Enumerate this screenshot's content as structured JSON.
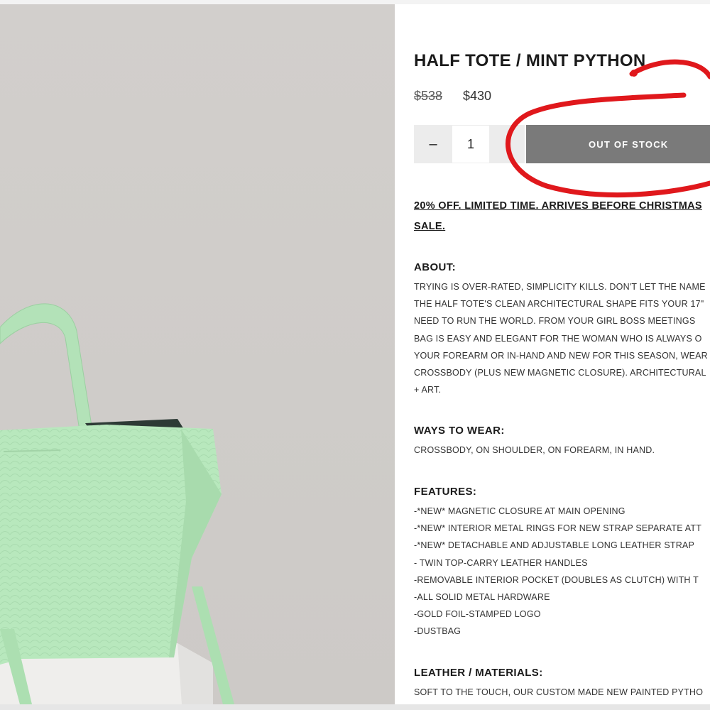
{
  "product": {
    "title": "HALF TOTE / MINT PYTHON",
    "price_original": "$538",
    "price_sale": "$430"
  },
  "cart": {
    "minus_label": "–",
    "quantity": "1",
    "button_label": "OUT OF STOCK"
  },
  "promo": {
    "lines": [
      "20% OFF. LIMITED TIME. ARRIVES BEFORE CHRISTMAS",
      "SALE."
    ]
  },
  "about": {
    "heading": "ABOUT:",
    "lines": [
      "TRYING IS OVER-RATED, SIMPLICITY KILLS. DON'T LET THE NAME",
      "THE HALF TOTE'S CLEAN ARCHITECTURAL SHAPE FITS YOUR 17\"",
      "NEED TO RUN THE WORLD.  FROM YOUR GIRL BOSS MEETINGS",
      "BAG IS EASY AND ELEGANT FOR THE WOMAN WHO IS ALWAYS O",
      "YOUR FOREARM OR IN-HAND AND NEW FOR THIS SEASON, WEAR",
      "CROSSBODY (PLUS NEW MAGNETIC CLOSURE). ARCHITECTURAL",
      "+ ART."
    ]
  },
  "ways": {
    "heading": "WAYS TO WEAR:",
    "lines": [
      "CROSSBODY, ON SHOULDER, ON FOREARM, IN HAND."
    ]
  },
  "features": {
    "heading": "FEATURES:",
    "lines": [
      "-*NEW* MAGNETIC CLOSURE AT MAIN OPENING",
      "-*NEW* INTERIOR METAL RINGS FOR NEW STRAP SEPARATE ATT",
      "-*NEW* DETACHABLE AND ADJUSTABLE LONG LEATHER STRAP",
      "- TWIN TOP-CARRY LEATHER HANDLES",
      "-REMOVABLE INTERIOR POCKET (DOUBLES AS CLUTCH) WITH T",
      "-ALL SOLID METAL HARDWARE",
      "-GOLD FOIL-STAMPED LOGO",
      "-DUSTBAG"
    ]
  },
  "materials": {
    "heading": "LEATHER / MATERIALS:",
    "lines": [
      "SOFT TO THE TOUCH, OUR CUSTOM MADE NEW PAINTED PYTHO"
    ]
  },
  "colors": {
    "bag": "#b8e8bd",
    "button": "#7a7a7a",
    "annotation": "#e0181c"
  }
}
